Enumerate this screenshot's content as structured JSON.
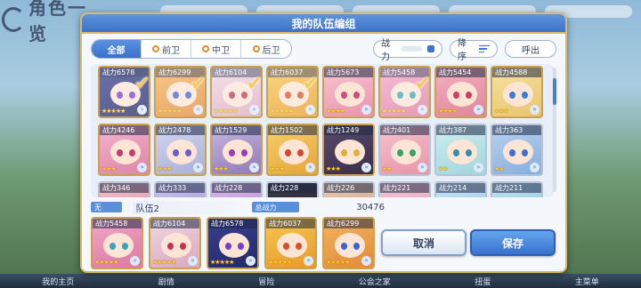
{
  "background": {
    "title": "角色一览",
    "nav": [
      "我的主页",
      "剧情",
      "冒险",
      "公会之家",
      "扭蛋",
      "主菜单"
    ]
  },
  "dialog": {
    "title": "我的队伍编组",
    "tabs": [
      "全部",
      "前卫",
      "中卫",
      "后卫"
    ],
    "sort_label": "战力",
    "order_label": "降序",
    "call_label": "呼出"
  },
  "roster": [
    {
      "power": "战力6578",
      "stars": "★★★★★",
      "selected": true,
      "c1": "#3a3f8f",
      "c2": "#232a66",
      "eye": "#7a3bd1"
    },
    {
      "power": "战力6299",
      "stars": "★★★★★",
      "selected": true,
      "c1": "#f3b45c",
      "c2": "#e38a3a",
      "eye": "#3b62d1"
    },
    {
      "power": "战力6104",
      "stars": "★★★★★",
      "selected": true,
      "c1": "#f1d8e2",
      "c2": "#d9a7bc",
      "eye": "#c23655"
    },
    {
      "power": "战力6037",
      "stars": "★★★★★",
      "selected": true,
      "c1": "#f7c74f",
      "c2": "#e89a2a",
      "eye": "#d6502e"
    },
    {
      "power": "战力5673",
      "stars": "★★★★",
      "selected": false,
      "c1": "#f7c4d2",
      "c2": "#e994ad",
      "eye": "#d04b7a"
    },
    {
      "power": "战力5458",
      "stars": "★★★★★",
      "selected": true,
      "c1": "#f2a6c4",
      "c2": "#db7aa3",
      "eye": "#3aa3b8"
    },
    {
      "power": "战力5454",
      "stars": "★★★★",
      "selected": false,
      "c1": "#f4b0c0",
      "c2": "#e0869c",
      "eye": "#d43a5a"
    },
    {
      "power": "战力4588",
      "stars": "★★★",
      "selected": false,
      "c1": "#f6e2a2",
      "c2": "#e7c56d",
      "eye": "#3a7fd4"
    },
    {
      "power": "战力4246",
      "stars": "★★★",
      "selected": false,
      "c1": "#f4b3cc",
      "c2": "#de85a8",
      "eye": "#c73b6b"
    },
    {
      "power": "战力2478",
      "stars": "★★★",
      "selected": false,
      "c1": "#d2d6ee",
      "c2": "#aab0d8",
      "eye": "#6f5bc9"
    },
    {
      "power": "战力1529",
      "stars": "★★★",
      "selected": false,
      "c1": "#c8b6dc",
      "c2": "#8f79b8",
      "eye": "#9b3bb8"
    },
    {
      "power": "战力1502",
      "stars": "★★★",
      "selected": false,
      "c1": "#f7cf6a",
      "c2": "#e4a63a",
      "eye": "#d1472f"
    },
    {
      "power": "战力1249",
      "stars": "★★★",
      "selected": false,
      "c1": "#5a4a6b",
      "c2": "#3a2e4a",
      "eye": "#e0b03a"
    },
    {
      "power": "战力401",
      "stars": "★★",
      "selected": false,
      "c1": "#f6c2cf",
      "c2": "#e894a8",
      "eye": "#3aa06a"
    },
    {
      "power": "战力387",
      "stars": "★★",
      "selected": false,
      "c1": "#cfeef0",
      "c2": "#9fd6dc",
      "eye": "#2f8fb0"
    },
    {
      "power": "战力363",
      "stars": "★★",
      "selected": false,
      "c1": "#b9d3ef",
      "c2": "#86aedc",
      "eye": "#3d6fd0"
    },
    {
      "power": "战力346",
      "stars": "★★",
      "selected": false,
      "c1": "#f3c0cc",
      "c2": "#df90a4",
      "eye": "#c9406a"
    },
    {
      "power": "战力333",
      "stars": "★★",
      "selected": false,
      "c1": "#c9c4ea",
      "c2": "#9d96d4",
      "eye": "#6b4fc0"
    },
    {
      "power": "战力228",
      "stars": "★★",
      "selected": false,
      "c1": "#dcb8e8",
      "c2": "#b388cf",
      "eye": "#8a3bb0"
    },
    {
      "power": "战力228",
      "stars": "★★",
      "selected": false,
      "c1": "#3c3a4a",
      "c2": "#24222e",
      "eye": "#d04040"
    },
    {
      "power": "战力226",
      "stars": "★★",
      "selected": false,
      "c1": "#e6c9b2",
      "c2": "#c9a082",
      "eye": "#3f6fc0"
    },
    {
      "power": "战力221",
      "stars": "★★",
      "selected": false,
      "c1": "#f4c7d6",
      "c2": "#e39bb3",
      "eye": "#c4406c"
    },
    {
      "power": "战力214",
      "stars": "★★",
      "selected": false,
      "c1": "#c9e4f6",
      "c2": "#99c4e6",
      "eye": "#3c7ed0"
    },
    {
      "power": "战力211",
      "stars": "★★",
      "selected": false,
      "c1": "#bfe2f2",
      "c2": "#8fc2de",
      "eye": "#2f88c0"
    }
  ],
  "team": {
    "badge": "无",
    "name": "队伍2",
    "power_label": "总战力",
    "power_total": "30476",
    "members": [
      {
        "power": "战力5458",
        "stars": "★★★★★",
        "c1": "#f2a6c4",
        "c2": "#db7aa3",
        "eye": "#3aa3b8"
      },
      {
        "power": "战力6104",
        "stars": "★★★★★",
        "c1": "#f1d8e2",
        "c2": "#d9a7bc",
        "eye": "#c23655"
      },
      {
        "power": "战力6578",
        "stars": "★★★★★",
        "c1": "#3a3f8f",
        "c2": "#232a66",
        "eye": "#7a3bd1"
      },
      {
        "power": "战力6037",
        "stars": "★★★★★",
        "c1": "#f7c74f",
        "c2": "#e89a2a",
        "eye": "#d6502e"
      },
      {
        "power": "战力6299",
        "stars": "★★★★★",
        "c1": "#f3b45c",
        "c2": "#e38a3a",
        "eye": "#3b62d1"
      }
    ],
    "cancel_label": "取消",
    "save_label": "保存"
  }
}
